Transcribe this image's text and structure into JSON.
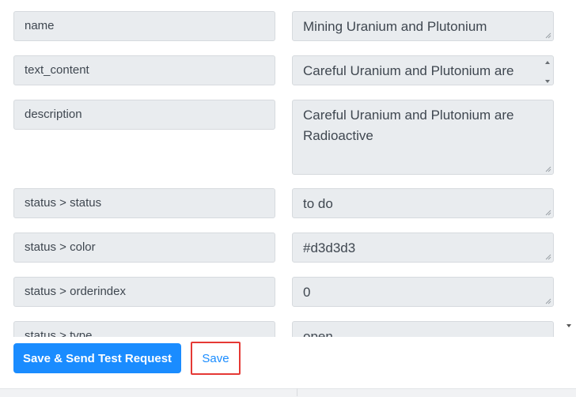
{
  "fields": [
    {
      "key": "name",
      "value": "Mining Uranium and Plutonium"
    },
    {
      "key": "text_content",
      "value": "Careful Uranium and Plutonium are Radioactive"
    },
    {
      "key": "description",
      "value": "Careful Uranium and Plutonium are Radioactive"
    },
    {
      "key": "status > status",
      "value": "to do"
    },
    {
      "key": "status > color",
      "value": "#d3d3d3"
    },
    {
      "key": "status > orderindex",
      "value": "0"
    },
    {
      "key": "status > type",
      "value": "open"
    }
  ],
  "footer": {
    "send_test_label": "Save & Send Test Request",
    "save_label": "Save"
  },
  "colors": {
    "primary": "#1a8cff",
    "highlight_border": "#e53935",
    "field_bg": "#e9ecef"
  }
}
